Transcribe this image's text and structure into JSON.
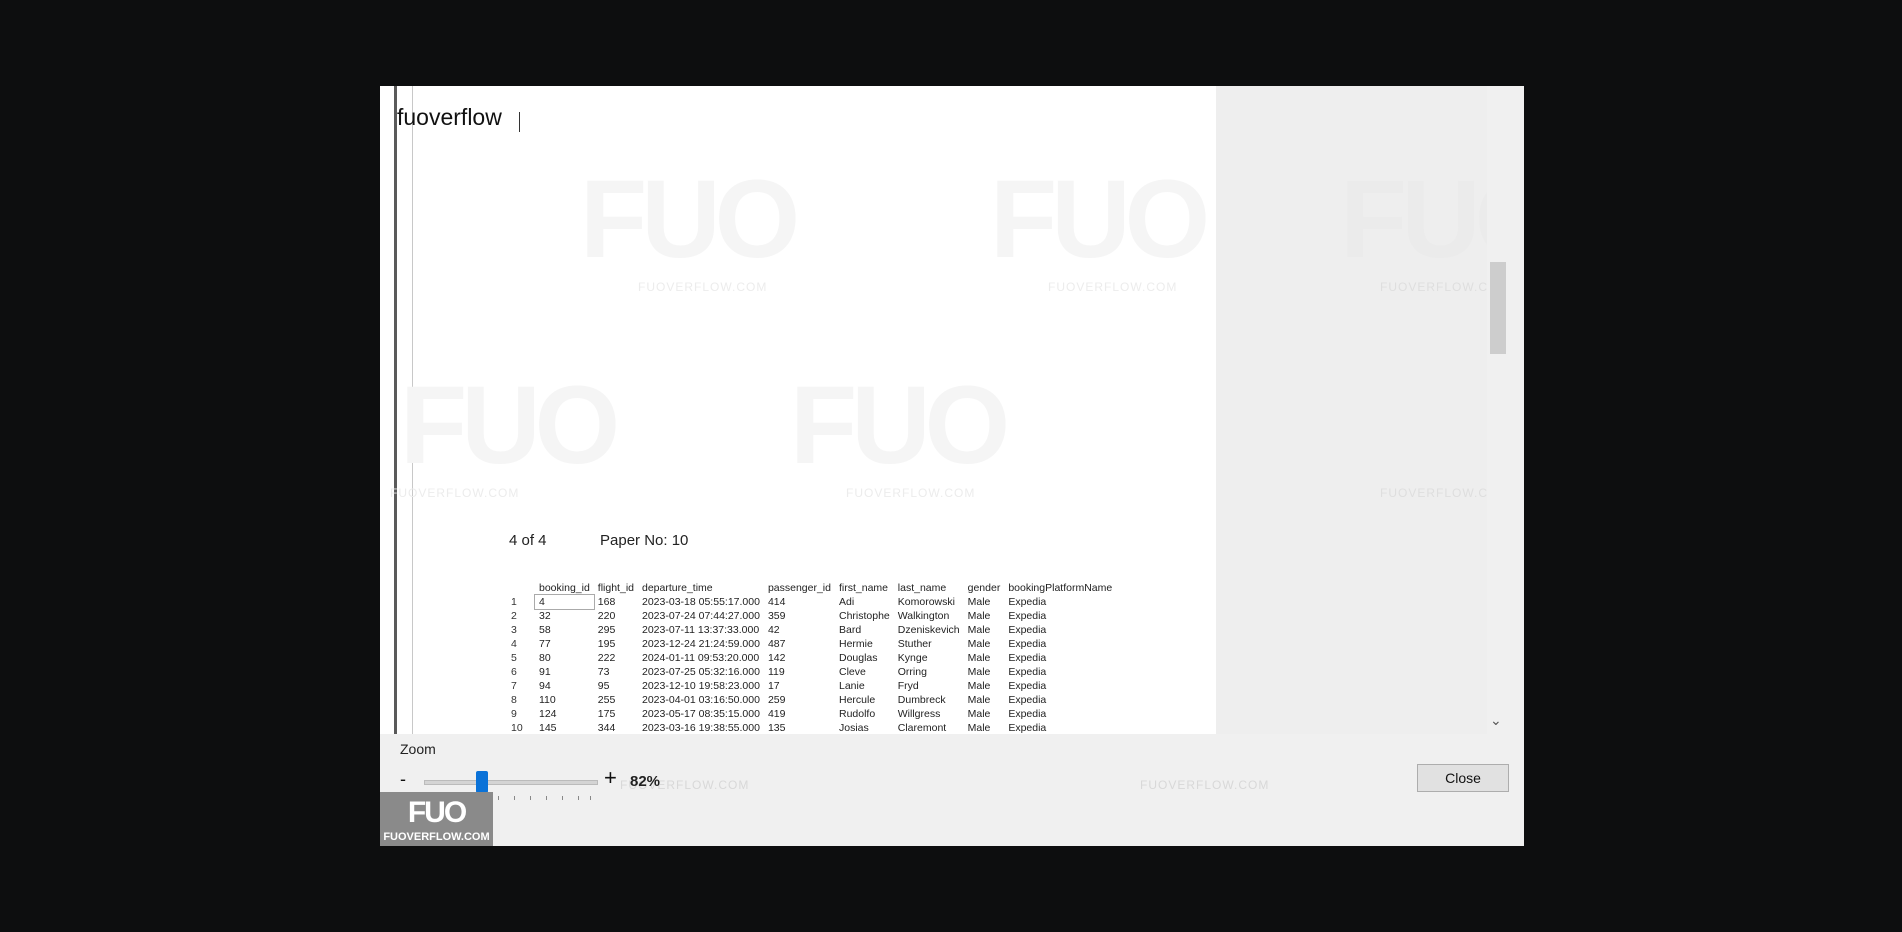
{
  "document": {
    "heading": "fuoverflow",
    "page_counter": "4 of 4",
    "paper_no": "Paper No: 10",
    "watermark_logo": "FUO",
    "watermark_text": "FUOVERFLOW.COM"
  },
  "table": {
    "columns": [
      "",
      "booking_id",
      "flight_id",
      "departure_time",
      "passenger_id",
      "first_name",
      "last_name",
      "gender",
      "bookingPlatformName"
    ],
    "rows": [
      [
        "1",
        "4",
        "168",
        "2023-03-18 05:55:17.000",
        "414",
        "Adi",
        "Komorowski",
        "Male",
        "Expedia"
      ],
      [
        "2",
        "32",
        "220",
        "2023-07-24 07:44:27.000",
        "359",
        "Christophe",
        "Walkington",
        "Male",
        "Expedia"
      ],
      [
        "3",
        "58",
        "295",
        "2023-07-11 13:37:33.000",
        "42",
        "Bard",
        "Dzeniskevich",
        "Male",
        "Expedia"
      ],
      [
        "4",
        "77",
        "195",
        "2023-12-24 21:24:59.000",
        "487",
        "Hermie",
        "Stuther",
        "Male",
        "Expedia"
      ],
      [
        "5",
        "80",
        "222",
        "2024-01-11 09:53:20.000",
        "142",
        "Douglas",
        "Kynge",
        "Male",
        "Expedia"
      ],
      [
        "6",
        "91",
        "73",
        "2023-07-25 05:32:16.000",
        "119",
        "Cleve",
        "Orring",
        "Male",
        "Expedia"
      ],
      [
        "7",
        "94",
        "95",
        "2023-12-10 19:58:23.000",
        "17",
        "Lanie",
        "Fryd",
        "Male",
        "Expedia"
      ],
      [
        "8",
        "110",
        "255",
        "2023-04-01 03:16:50.000",
        "259",
        "Hercule",
        "Dumbreck",
        "Male",
        "Expedia"
      ],
      [
        "9",
        "124",
        "175",
        "2023-05-17 08:35:15.000",
        "419",
        "Rudolfo",
        "Willgress",
        "Male",
        "Expedia"
      ],
      [
        "10",
        "145",
        "344",
        "2023-03-16 19:38:55.000",
        "135",
        "Josias",
        "Claremont",
        "Male",
        "Expedia"
      ]
    ]
  },
  "zoom": {
    "label": "Zoom",
    "minus": "-",
    "plus": "+",
    "value": "82%",
    "slider_fraction": 0.35
  },
  "buttons": {
    "close": "Close"
  },
  "logo": {
    "mark": "FUO",
    "text": "FUOVERFLOW.COM"
  },
  "icons": {
    "scroll_down": "chevron-down-icon"
  },
  "colors": {
    "slider_knob": "#0a72d8",
    "background": "#0d0e0f"
  }
}
